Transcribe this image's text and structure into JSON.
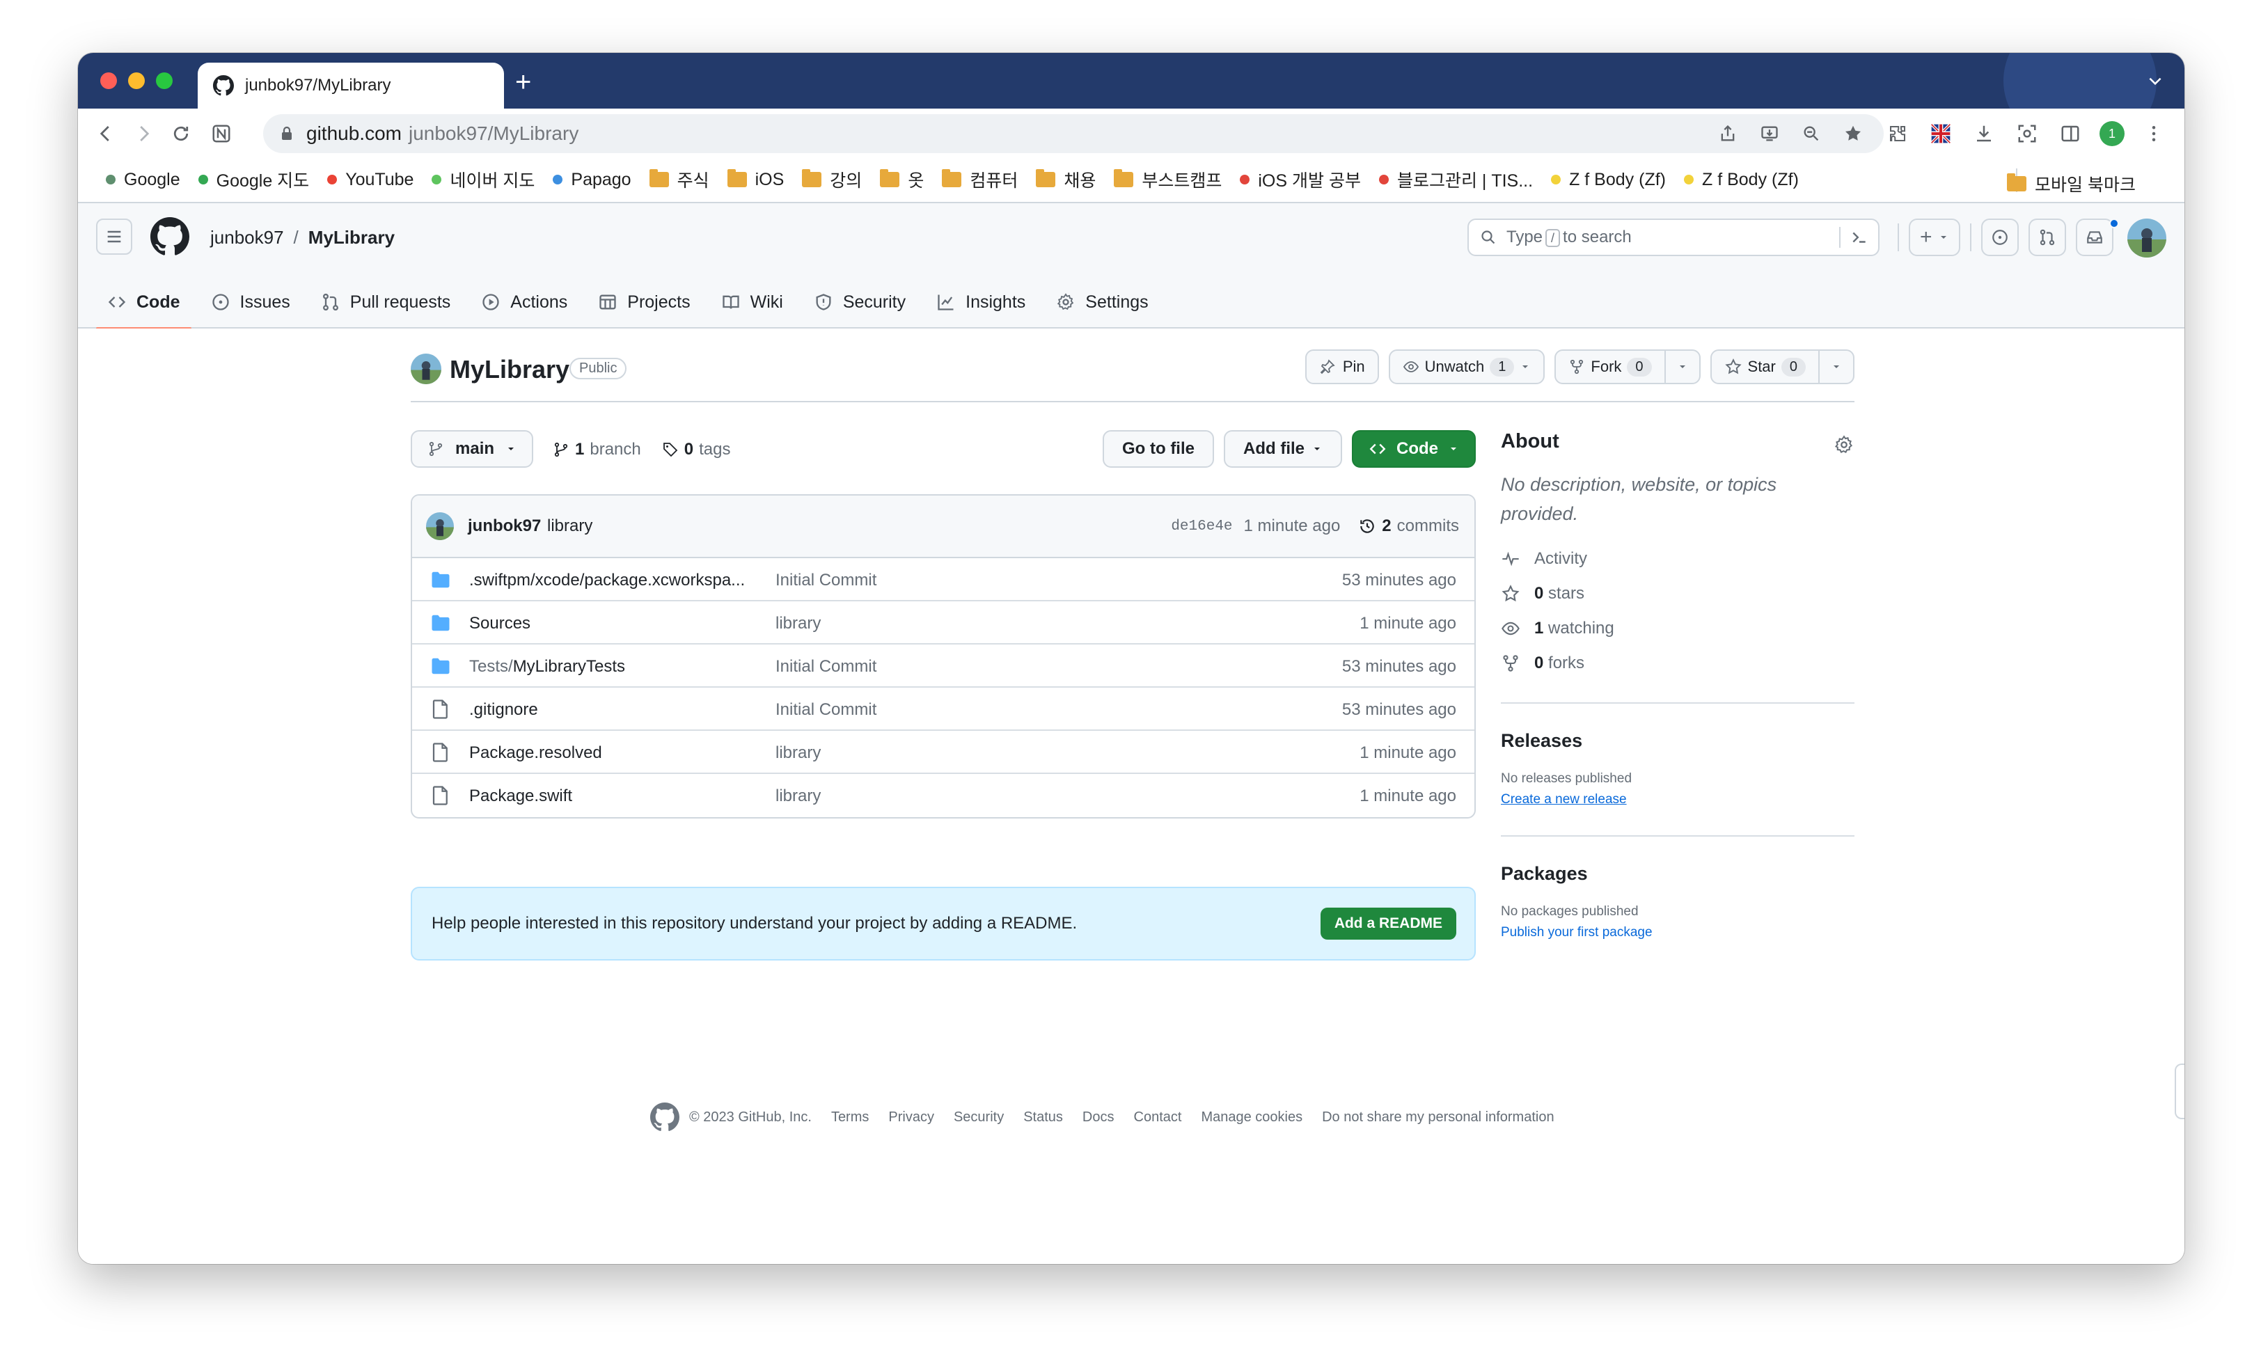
{
  "browser": {
    "tab_title": "junbok97/MyLibrary",
    "new_tab": "+",
    "url_host": "github.com",
    "url_path": "junbok97/MyLibrary",
    "profile_badge": "1"
  },
  "bookmarks": [
    {
      "label": "Google",
      "kind": "dot",
      "color": "#5f8f6f"
    },
    {
      "label": "Google 지도",
      "kind": "dot",
      "color": "#34a853"
    },
    {
      "label": "YouTube",
      "kind": "dot",
      "color": "#ea4335"
    },
    {
      "label": "네이버 지도",
      "kind": "dot",
      "color": "#5ec45e"
    },
    {
      "label": "Papago",
      "kind": "dot",
      "color": "#3d8fe0"
    },
    {
      "label": "주식",
      "kind": "folder"
    },
    {
      "label": "iOS",
      "kind": "folder"
    },
    {
      "label": "강의",
      "kind": "folder"
    },
    {
      "label": "옷",
      "kind": "folder"
    },
    {
      "label": "컴퓨터",
      "kind": "folder"
    },
    {
      "label": "채용",
      "kind": "folder"
    },
    {
      "label": "부스트캠프",
      "kind": "folder"
    },
    {
      "label": "iOS 개발 공부",
      "kind": "dot",
      "color": "#e2453b"
    },
    {
      "label": "블로그관리 | TIS...",
      "kind": "dot",
      "color": "#e2453b"
    },
    {
      "label": "Z f Body (Zf)",
      "kind": "dot",
      "color": "#f2d23a"
    },
    {
      "label": "Z f Body (Zf)",
      "kind": "dot",
      "color": "#f2d23a"
    }
  ],
  "bookmarks_right": "모바일 북마크",
  "header": {
    "owner": "junbok97",
    "slash": "/",
    "repo": "MyLibrary",
    "search_pre": "Type",
    "search_key": "/",
    "search_post": "to search",
    "plus": "+"
  },
  "repo_nav": [
    {
      "label": "Code",
      "icon": "code-icon",
      "active": true
    },
    {
      "label": "Issues",
      "icon": "issue-icon"
    },
    {
      "label": "Pull requests",
      "icon": "pull-request-icon"
    },
    {
      "label": "Actions",
      "icon": "play-icon"
    },
    {
      "label": "Projects",
      "icon": "table-icon"
    },
    {
      "label": "Wiki",
      "icon": "book-icon"
    },
    {
      "label": "Security",
      "icon": "shield-icon"
    },
    {
      "label": "Insights",
      "icon": "graph-icon"
    },
    {
      "label": "Settings",
      "icon": "gear-icon"
    }
  ],
  "repo": {
    "name": "MyLibrary",
    "visibility": "Public",
    "pin": "Pin",
    "unwatch": "Unwatch",
    "watch_count": "1",
    "fork": "Fork",
    "fork_count": "0",
    "star": "Star",
    "star_count": "0"
  },
  "branch": {
    "name": "main",
    "branch_count": "1",
    "branch_label": "branch",
    "tag_count": "0",
    "tag_label": "tags",
    "go_to_file": "Go to file",
    "add_file": "Add file",
    "code": "Code"
  },
  "latest_commit": {
    "user": "junbok97",
    "message": "library",
    "sha": "de16e4e",
    "time": "1 minute ago",
    "commit_count": "2",
    "commit_label": "commits"
  },
  "files": [
    {
      "type": "folder",
      "dim": "",
      "name": ".swiftpm/xcode/package.xcworkspa...",
      "message": "Initial Commit",
      "time": "53 minutes ago"
    },
    {
      "type": "folder",
      "dim": "",
      "name": "Sources",
      "message": "library",
      "time": "1 minute ago"
    },
    {
      "type": "folder",
      "dim": "Tests/",
      "name": "MyLibraryTests",
      "message": "Initial Commit",
      "time": "53 minutes ago"
    },
    {
      "type": "file",
      "dim": "",
      "name": ".gitignore",
      "message": "Initial Commit",
      "time": "53 minutes ago"
    },
    {
      "type": "file",
      "dim": "",
      "name": "Package.resolved",
      "message": "library",
      "time": "1 minute ago"
    },
    {
      "type": "file",
      "dim": "",
      "name": "Package.swift",
      "message": "library",
      "time": "1 minute ago"
    }
  ],
  "readme": {
    "text": "Help people interested in this repository understand your project by adding a README.",
    "button": "Add a README"
  },
  "about": {
    "title": "About",
    "description": "No description, website, or topics provided.",
    "activity": "Activity",
    "stars_count": "0",
    "stars_label": "stars",
    "watching_count": "1",
    "watching_label": "watching",
    "forks_count": "0",
    "forks_label": "forks"
  },
  "releases": {
    "title": "Releases",
    "note": "No releases published",
    "link": "Create a new release"
  },
  "packages": {
    "title": "Packages",
    "note": "No packages published",
    "link": "Publish your first package"
  },
  "footer": {
    "copyright": "© 2023 GitHub, Inc.",
    "links": [
      "Terms",
      "Privacy",
      "Security",
      "Status",
      "Docs",
      "Contact",
      "Manage cookies",
      "Do not share my personal information"
    ]
  },
  "colors": {
    "tabbar": "#233a6b",
    "accent_green": "#1f883d",
    "tab_underline": "#fd8c73",
    "link": "#0969da",
    "folder_icon": "#54aeff"
  }
}
